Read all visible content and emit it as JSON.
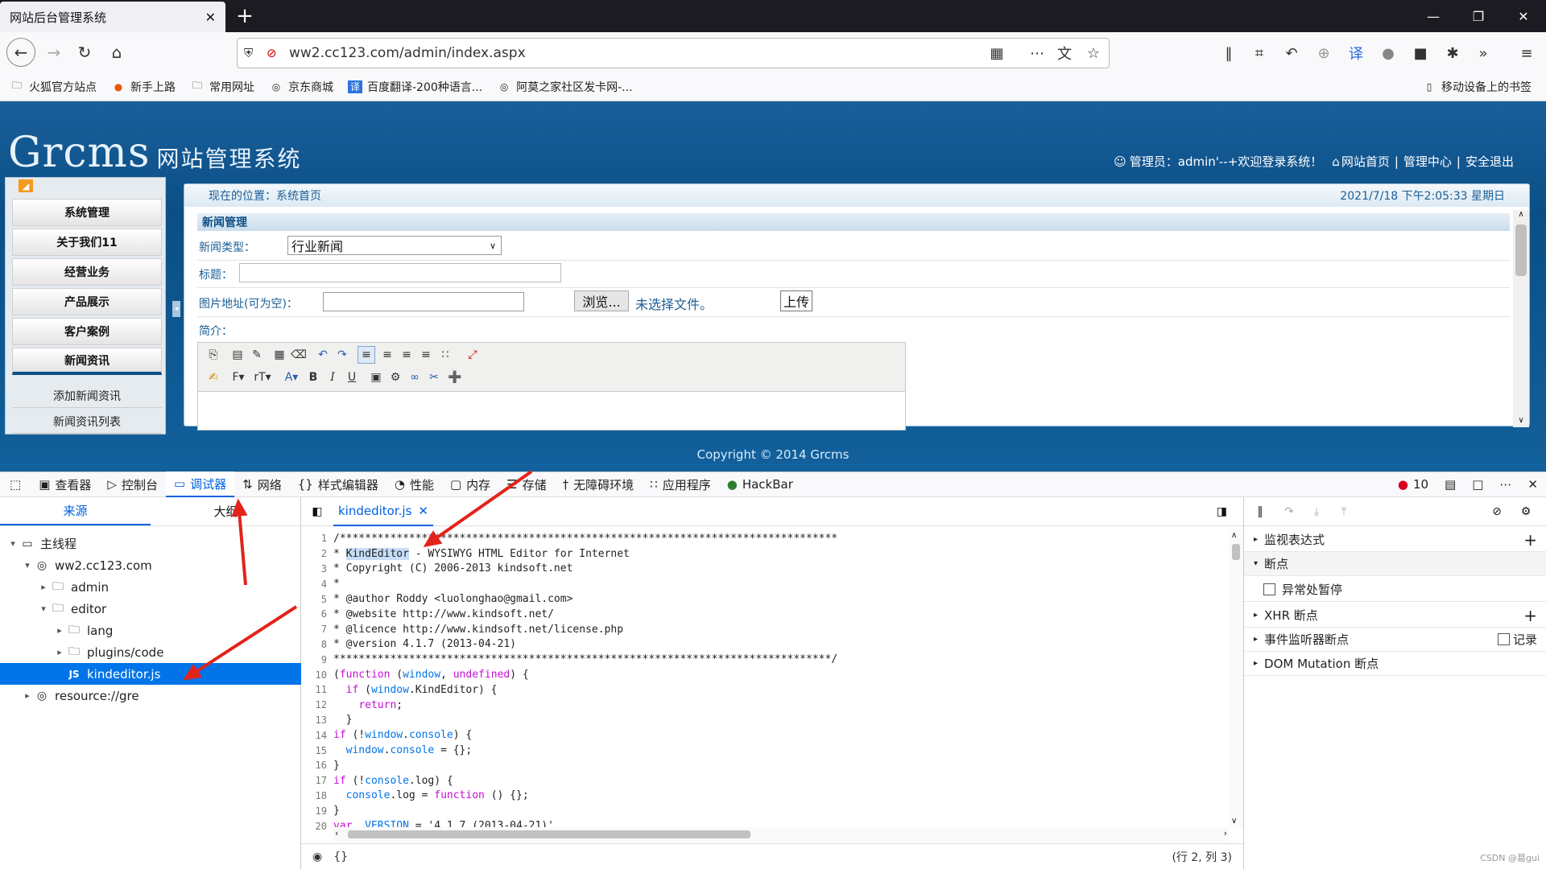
{
  "browser": {
    "tab_title": "网站后台管理系统",
    "tab_close": "✕",
    "new_tab": "+",
    "url": "ww2.cc123.com/admin/index.aspx"
  },
  "bookmarks": {
    "items": [
      "火狐官方站点",
      "新手上路",
      "常用网址",
      "京东商城",
      "百度翻译-200种语言...",
      "阿莫之家社区发卡网-..."
    ],
    "mobile": "移动设备上的书签"
  },
  "site": {
    "logo": "Grcms",
    "logo_sub": "网站管理系统",
    "admin_info": "管理员：admin'--+欢迎登录系统！",
    "link_home": "网站首页",
    "link_center": "管理中心",
    "link_logout": "安全退出",
    "location": "现在的位置：系统首页",
    "datetime": "2021/7/18  下午2:05:33  星期日",
    "copyright": "Copyright © 2014 Grcms"
  },
  "sidebar": {
    "items": [
      "系统管理",
      "关于我们11",
      "经营业务",
      "产品展示",
      "客户案例",
      "新闻资讯"
    ],
    "subitems": [
      "添加新闻资讯",
      "新闻资讯列表"
    ]
  },
  "form": {
    "section_title": "新闻管理",
    "type_label": "新闻类型：",
    "type_value": "行业新闻",
    "title_label": "标题：",
    "image_label": "图片地址(可为空)：",
    "browse_btn": "浏览...",
    "no_file": "未选择文件。",
    "upload_btn": "上传",
    "intro_label": "简介："
  },
  "devtools": {
    "tools": [
      "查看器",
      "控制台",
      "调试器",
      "网络",
      "样式编辑器",
      "性能",
      "内存",
      "存储",
      "无障碍环境",
      "应用程序",
      "HackBar"
    ],
    "error_count": "10",
    "left_tabs": [
      "来源",
      "大纲"
    ],
    "tree": [
      "主线程",
      "ww2.cc123.com",
      "admin",
      "editor",
      "lang",
      "plugins/code",
      "kindeditor.js",
      "resource://gre"
    ],
    "file_tab": "kindeditor.js",
    "code_lines": [
      {
        "n": "1",
        "t": "/*******************************************************************************"
      },
      {
        "n": "2",
        "t": "* KindEditor - WYSIWYG HTML Editor for Internet"
      },
      {
        "n": "3",
        "t": "* Copyright (C) 2006-2013 kindsoft.net"
      },
      {
        "n": "4",
        "t": "*"
      },
      {
        "n": "5",
        "t": "* @author Roddy <luolonghao@gmail.com>"
      },
      {
        "n": "6",
        "t": "* @website http://www.kindsoft.net/"
      },
      {
        "n": "7",
        "t": "* @licence http://www.kindsoft.net/license.php"
      },
      {
        "n": "8",
        "t": "* @version 4.1.7 (2013-04-21)"
      },
      {
        "n": "9",
        "t": "*******************************************************************************/"
      },
      {
        "n": "10",
        "t": "(function (window, undefined) {"
      },
      {
        "n": "11",
        "t": "  if (window.KindEditor) {"
      },
      {
        "n": "12",
        "t": "    return;"
      },
      {
        "n": "13",
        "t": "  }"
      },
      {
        "n": "14",
        "t": "if (!window.console) {"
      },
      {
        "n": "15",
        "t": "  window.console = {};"
      },
      {
        "n": "16",
        "t": "}"
      },
      {
        "n": "17",
        "t": "if (!console.log) {"
      },
      {
        "n": "18",
        "t": "  console.log = function () {};"
      },
      {
        "n": "19",
        "t": "}"
      },
      {
        "n": "20",
        "t": "var _VERSION = '4.1.7 (2013-04-21)',"
      }
    ],
    "status_left": "{}",
    "status_right": "(行 2, 列 3)",
    "right_sections": [
      "监视表达式",
      "断点",
      "异常处暂停",
      "XHR 断点",
      "事件监听器断点",
      "记录",
      "DOM Mutation 断点"
    ],
    "watermark": "CSDN @葛gui"
  }
}
